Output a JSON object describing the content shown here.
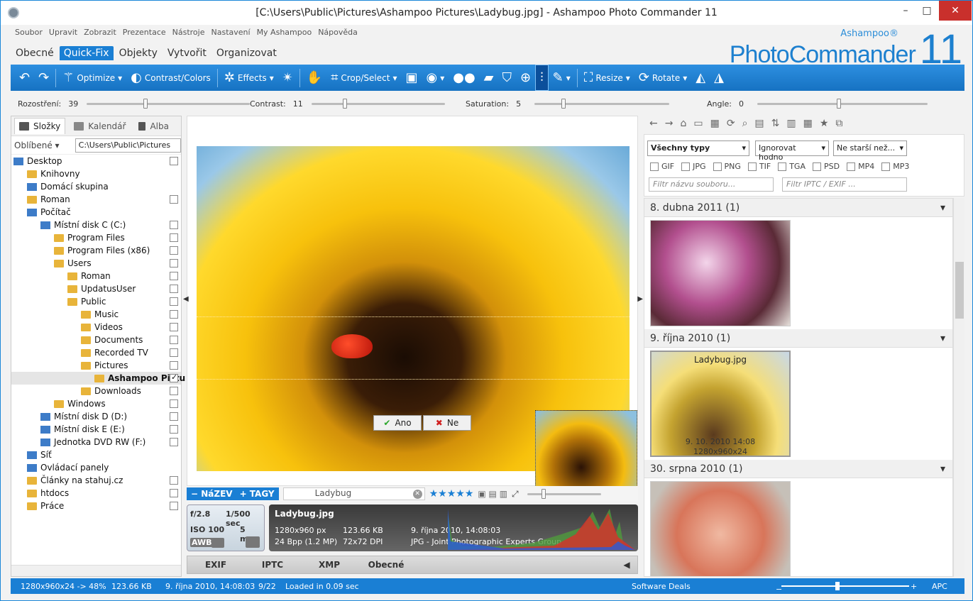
{
  "window": {
    "title": "[C:\\Users\\Public\\Pictures\\Ashampoo Pictures\\Ladybug.jpg] - Ashampoo Photo Commander 11",
    "minimize": "–",
    "maximize": "□",
    "close": "✕"
  },
  "menu": [
    "Soubor",
    "Upravit",
    "Zobrazit",
    "Prezentace",
    "Nástroje",
    "Nastavení",
    "My Ashampoo",
    "Nápověda"
  ],
  "tabs": [
    "Obecné",
    "Quick-Fix",
    "Objekty",
    "Vytvořit",
    "Organizovat"
  ],
  "active_tab": "Quick-Fix",
  "logo": {
    "small": "Ashampoo®",
    "big": "PhotoCommander",
    "num": "11"
  },
  "toolbar": {
    "optimize": "Optimize",
    "contrast": "Contrast/Colors",
    "effects": "Effects",
    "crop": "Crop/Select",
    "resize": "Resize",
    "rotate": "Rotate"
  },
  "sliders": {
    "rozostreni": {
      "label": "Rozostření:",
      "value": "39"
    },
    "contrast": {
      "label": "Contrast:",
      "value": "11"
    },
    "saturation": {
      "label": "Saturation:",
      "value": "5"
    },
    "angle": {
      "label": "Angle:",
      "value": "0"
    }
  },
  "left": {
    "tabs": [
      "Složky",
      "Kalendář",
      "Alba"
    ],
    "fav": "Oblíbené",
    "path": "C:\\Users\\Public\\Pictures",
    "tree": [
      {
        "label": "Desktop",
        "indent": 0,
        "icon": "pc",
        "chk": true
      },
      {
        "label": "Knihovny",
        "indent": 1,
        "icon": "fold",
        "chk": false
      },
      {
        "label": "Domácí skupina",
        "indent": 1,
        "icon": "pc",
        "chk": false
      },
      {
        "label": "Roman",
        "indent": 1,
        "icon": "fold",
        "chk": true
      },
      {
        "label": "Počítač",
        "indent": 1,
        "icon": "pc",
        "chk": false
      },
      {
        "label": "Místní disk C (C:)",
        "indent": 2,
        "icon": "pc",
        "chk": true
      },
      {
        "label": "Program Files",
        "indent": 3,
        "icon": "fold",
        "chk": true
      },
      {
        "label": "Program Files (x86)",
        "indent": 3,
        "icon": "fold",
        "chk": true
      },
      {
        "label": "Users",
        "indent": 3,
        "icon": "fold",
        "chk": true
      },
      {
        "label": "Roman",
        "indent": 4,
        "icon": "fold",
        "chk": true
      },
      {
        "label": "UpdatusUser",
        "indent": 4,
        "icon": "fold",
        "chk": true
      },
      {
        "label": "Public",
        "indent": 4,
        "icon": "fold",
        "chk": true
      },
      {
        "label": "Music",
        "indent": 5,
        "icon": "fold",
        "chk": true
      },
      {
        "label": "Videos",
        "indent": 5,
        "icon": "fold",
        "chk": true
      },
      {
        "label": "Documents",
        "indent": 5,
        "icon": "fold",
        "chk": true
      },
      {
        "label": "Recorded TV",
        "indent": 5,
        "icon": "fold",
        "chk": true
      },
      {
        "label": "Pictures",
        "indent": 5,
        "icon": "fold",
        "chk": true
      },
      {
        "label": "Ashampoo Pictu",
        "indent": 6,
        "icon": "fold",
        "chk": true,
        "sel": true
      },
      {
        "label": "Downloads",
        "indent": 5,
        "icon": "fold",
        "chk": true
      },
      {
        "label": "Windows",
        "indent": 3,
        "icon": "fold",
        "chk": true
      },
      {
        "label": "Místní disk D (D:)",
        "indent": 2,
        "icon": "pc",
        "chk": true
      },
      {
        "label": "Místní disk E (E:)",
        "indent": 2,
        "icon": "pc",
        "chk": true
      },
      {
        "label": "Jednotka DVD RW (F:)",
        "indent": 2,
        "icon": "pc",
        "chk": true
      },
      {
        "label": "Síť",
        "indent": 1,
        "icon": "pc",
        "chk": false
      },
      {
        "label": "Ovládací panely",
        "indent": 1,
        "icon": "pc",
        "chk": false
      },
      {
        "label": "Články na stahuj.cz",
        "indent": 1,
        "icon": "fold",
        "chk": true
      },
      {
        "label": "htdocs",
        "indent": 1,
        "icon": "fold",
        "chk": true
      },
      {
        "label": "Práce",
        "indent": 1,
        "icon": "fold",
        "chk": true
      }
    ]
  },
  "viewer": {
    "ano": "Ano",
    "ne": "Ne"
  },
  "info": {
    "nazev": "NáZEV",
    "tagy": "TAGY",
    "name": "Ladybug"
  },
  "camera": {
    "aperture": "f/2.8",
    "shutter": "1/500 sec",
    "iso": "ISO 100",
    "focal": "5 mm",
    "awb": "AWB"
  },
  "file": {
    "name": "Ladybug.jpg",
    "dims": "1280x960 px",
    "size": "123.66 KB",
    "date": "9. října 2010, 14:08:03",
    "bpp": "24 Bpp (1.2 MP)",
    "dpi": "72x72 DPI",
    "format": "JPG - Joint Photographic Experts Group"
  },
  "metatabs": [
    "EXIF",
    "IPTC",
    "XMP",
    "Obecné"
  ],
  "filter": {
    "types": "Všechny typy",
    "case": "Ignorovat hodno",
    "age": "Ne starší než...",
    "ftypes": [
      "GIF",
      "JPG",
      "PNG",
      "TIF",
      "TGA",
      "PSD",
      "MP4",
      "MP3"
    ],
    "name_ph": "Filtr názvu souboru...",
    "iptc_ph": "Filtr IPTC / EXIF ..."
  },
  "gallery": [
    {
      "date": "8. dubna 2011 (1)"
    },
    {
      "date": "9. října 2010 (1)",
      "name": "Ladybug.jpg",
      "taken": "9. 10. 2010 14:08",
      "dims": "1280x960x24"
    },
    {
      "date": "30. srpna 2010 (1)"
    }
  ],
  "status": {
    "res": "1280x960x24 -> 48%",
    "size": "123.66 KB",
    "date": "9. října 2010, 14:08:03",
    "count": "9/22",
    "loaded": "Loaded in 0.09 sec",
    "deals": "Software Deals",
    "mode": "APC"
  }
}
